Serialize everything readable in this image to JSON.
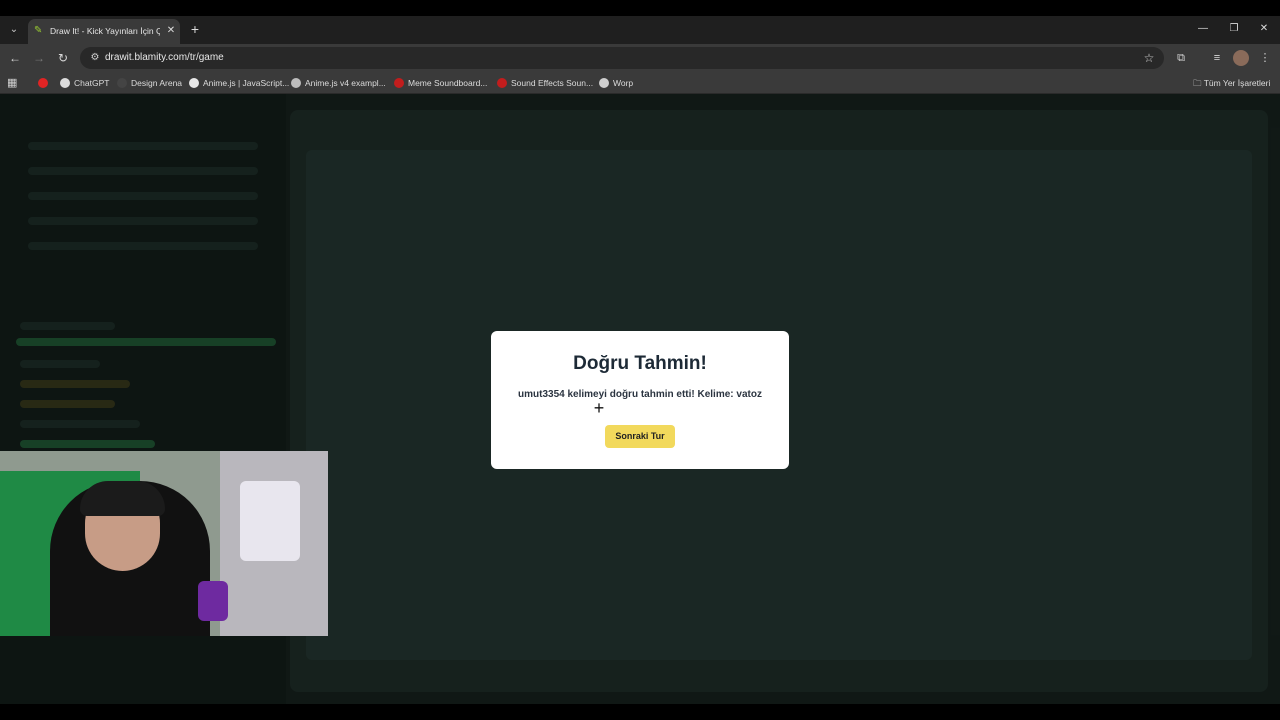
{
  "browser": {
    "tab_title": "Draw It! - Kick Yayınları İçin Çiz",
    "url": "drawit.blamity.com/tr/game",
    "bookmarks": [
      {
        "label": "",
        "icon": "youtube-icon"
      },
      {
        "label": "ChatGPT",
        "icon": "chatgpt-icon"
      },
      {
        "label": "Design Arena",
        "icon": "design-arena-icon"
      },
      {
        "label": "Anime.js | JavaScript...",
        "icon": "animejs-icon"
      },
      {
        "label": "Anime.js v4 exampl...",
        "icon": "codepen-icon"
      },
      {
        "label": "Meme Soundboard...",
        "icon": "sound-icon"
      },
      {
        "label": "Sound Effects Soun...",
        "icon": "sound-icon"
      },
      {
        "label": "Worp",
        "icon": "worp-icon"
      }
    ],
    "all_bookmarks_label": "Tüm Yer İşaretleri"
  },
  "modal": {
    "title": "Doğru Tahmin!",
    "message": "umut3354 kelimeyi doğru tahmin etti! Kelime: vatoz",
    "next_button": "Sonraki Tur"
  },
  "colors": {
    "modal_bg": "#ffffff",
    "button_bg": "#f2d95c",
    "page_bg": "#151d1a"
  }
}
